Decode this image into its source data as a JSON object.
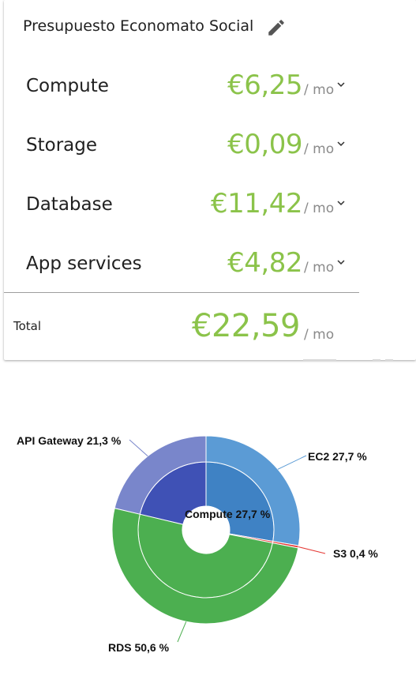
{
  "header": {
    "title": "Presupuesto Economato Social",
    "edit_icon": "pencil-icon"
  },
  "rows": [
    {
      "label": "Compute",
      "price": "€6,25",
      "unit": "/ mo"
    },
    {
      "label": "Storage",
      "price": "€0,09",
      "unit": "/ mo"
    },
    {
      "label": "Database",
      "price": "€11,42",
      "unit": "/ mo"
    },
    {
      "label": "App services",
      "price": "€4,82",
      "unit": "/ mo"
    }
  ],
  "total": {
    "label": "Total",
    "price": "€22,59",
    "unit": "/ mo"
  },
  "colors": {
    "price_green": "#8bc34a",
    "compute_inner": "#3f82c4",
    "ec2_outer": "#5b9bd5",
    "s3": "#e53935",
    "database_inner": "#4caf50",
    "rds_outer": "#4caf50",
    "app_inner": "#3f51b5",
    "apigw_outer": "#7986cb"
  },
  "chart_data": {
    "type": "pie",
    "rings": [
      {
        "ring": "inner",
        "slices": [
          {
            "name": "Compute",
            "value": 27.7,
            "color": "#3f82c4"
          },
          {
            "name": "Storage",
            "value": 0.4,
            "color": "#e53935"
          },
          {
            "name": "Database",
            "value": 50.6,
            "color": "#4caf50"
          },
          {
            "name": "App services",
            "value": 21.3,
            "color": "#3f51b5"
          }
        ]
      },
      {
        "ring": "outer",
        "slices": [
          {
            "name": "EC2",
            "value": 27.7,
            "color": "#5b9bd5"
          },
          {
            "name": "S3",
            "value": 0.4,
            "color": "#e53935"
          },
          {
            "name": "RDS",
            "value": 50.6,
            "color": "#4caf50"
          },
          {
            "name": "API Gateway",
            "value": 21.3,
            "color": "#7986cb"
          }
        ]
      }
    ],
    "labels": {
      "center": "Compute 27,7 %",
      "ec2": "EC2 27,7 %",
      "s3": "S3 0,4 %",
      "rds": "RDS 50,6 %",
      "apigw": "API Gateway 21,3 %"
    }
  }
}
